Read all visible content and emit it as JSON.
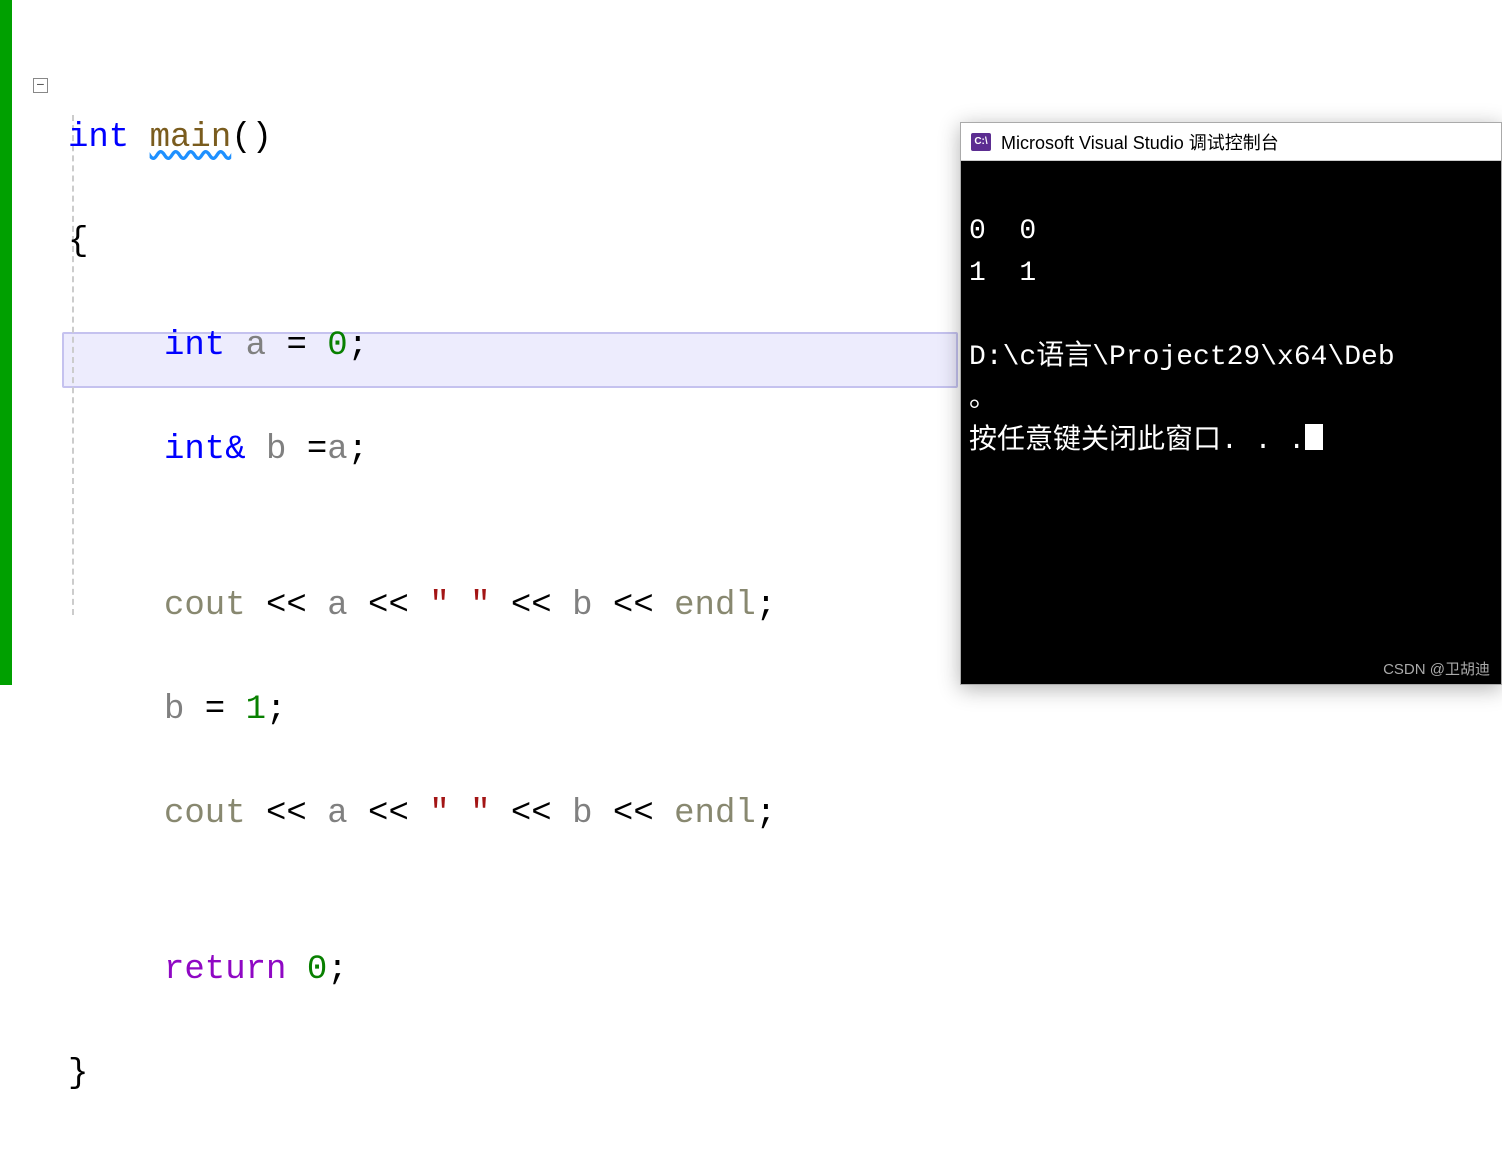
{
  "editor": {
    "lines": {
      "l1": {
        "kw": "int",
        "func": "main",
        "parens": "()"
      },
      "l2": "{",
      "l3": {
        "kw": "int",
        "ident": " a ",
        "ops": "=",
        "num": " 0",
        "semi": ";"
      },
      "l4": {
        "kw": "int",
        "amp": "& ",
        "ident": "b ",
        "ops": "=",
        "ident2": "a",
        "semi": ";"
      },
      "l5_blank": "",
      "l6": {
        "cout": "cout",
        "op1": " << ",
        "a": "a",
        "op2": " << ",
        "str": "\" \"",
        "op3": " << ",
        "b": "b",
        "op4": " << ",
        "endl": "endl",
        "semi": ";"
      },
      "l7": {
        "b": "b",
        "ops": " = ",
        "num": "1",
        "semi": ";"
      },
      "l8": {
        "cout": "cout",
        "op1": " << ",
        "a": "a",
        "op2": " << ",
        "str": "\" \"",
        "op3": " << ",
        "b": "b",
        "op4": " << ",
        "endl": "endl",
        "semi": ";"
      },
      "l9_blank": "",
      "l10": {
        "kw": "return",
        "num": " 0",
        "semi": ";"
      },
      "l11": "}"
    }
  },
  "console": {
    "title": "Microsoft Visual Studio 调试控制台",
    "icon_text": "C:\\",
    "output_line1": "0  0",
    "output_line2": "1  1",
    "output_line3": "",
    "path_line": "D:\\c语言\\Project29\\x64\\Deb",
    "circle_line": "。",
    "prompt_line": "按任意键关闭此窗口. . ."
  },
  "watermark": "CSDN @卫胡迪"
}
